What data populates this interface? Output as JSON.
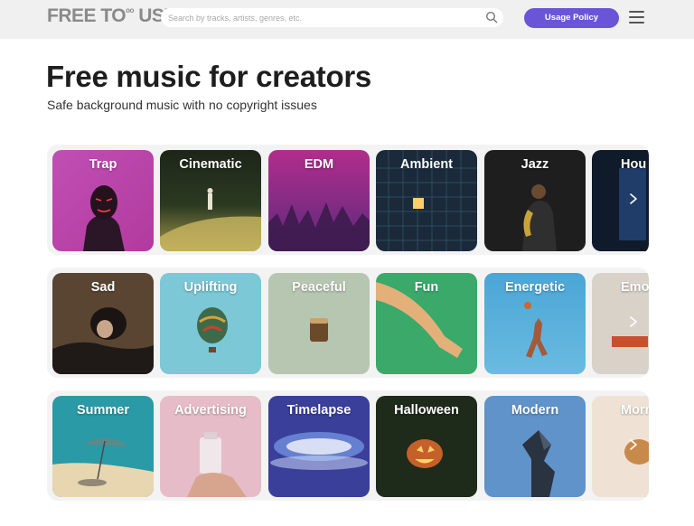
{
  "header": {
    "logo_text": "FREE TO",
    "logo_sup": "oo",
    "logo_tail": "USE",
    "search_placeholder": "Search by tracks, artists, genres, etc.",
    "search_icon": "search-icon",
    "usage_button": "Usage Policy",
    "menu_icon": "hamburger-menu-icon"
  },
  "hero": {
    "title": "Free music for creators",
    "subtitle": "Safe background music with no copyright issues"
  },
  "rows": [
    {
      "name": "genres",
      "items": [
        "Trap",
        "Cinematic",
        "EDM",
        "Ambient",
        "Jazz",
        "Hou"
      ]
    },
    {
      "name": "moods",
      "items": [
        "Sad",
        "Uplifting",
        "Peaceful",
        "Fun",
        "Energetic",
        "Emoti"
      ]
    },
    {
      "name": "themes",
      "items": [
        "Summer",
        "Advertising",
        "Timelapse",
        "Halloween",
        "Modern",
        "Morn"
      ]
    }
  ],
  "colors": {
    "accent": "#6a55d8",
    "header_bg": "#f0f0f0",
    "row_bg": "#f3f3f3"
  },
  "icons": {
    "next_arrow": "chevron-right-icon"
  }
}
